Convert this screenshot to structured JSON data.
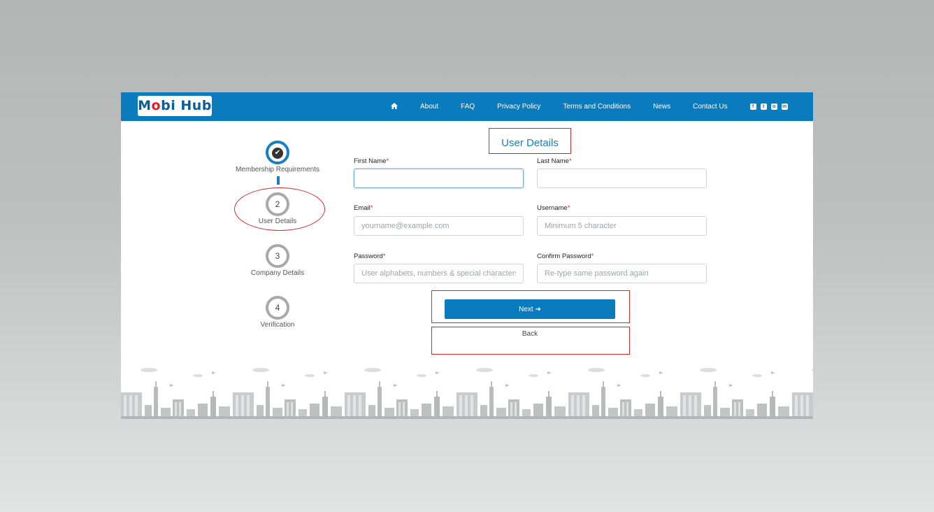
{
  "header": {
    "logo": {
      "part1": "M",
      "dot_char": "o",
      "part2": "bi Hub"
    },
    "nav": {
      "home_icon": "home-icon",
      "items": [
        "About",
        "FAQ",
        "Privacy Policy",
        "Terms and Conditions",
        "News",
        "Contact Us"
      ]
    },
    "social_icons": [
      "facebook-icon",
      "twitter-icon",
      "instagram-icon",
      "linkedin-icon"
    ],
    "colors": {
      "bar": "#0a7bbd"
    }
  },
  "stepper": {
    "steps": [
      {
        "number": "✔",
        "label": "Membership Requirements",
        "state": "done"
      },
      {
        "number": "2",
        "label": "User Details",
        "state": "current"
      },
      {
        "number": "3",
        "label": "Company Details",
        "state": "pending"
      },
      {
        "number": "4",
        "label": "Verification",
        "state": "pending"
      }
    ]
  },
  "form": {
    "title": "User Details",
    "fields": {
      "first_name": {
        "label": "First Name",
        "req": "*",
        "value": "",
        "placeholder": ""
      },
      "last_name": {
        "label": "Last Name",
        "req": "*",
        "value": "",
        "placeholder": ""
      },
      "email": {
        "label": "Email",
        "req": "*",
        "value": "",
        "placeholder": "yourname@example.com"
      },
      "username": {
        "label": "Username",
        "req": "*",
        "value": "",
        "placeholder": "Minimum 5 character"
      },
      "password": {
        "label": "Password",
        "req": "*",
        "value": "",
        "placeholder": "User alphabets, numbers & special characters"
      },
      "confirm_password": {
        "label": "Confirm Password",
        "req": "*",
        "value": "",
        "placeholder": "Re-type same password again"
      }
    },
    "next_label": "Next ➔",
    "back_label": "Back"
  },
  "colors": {
    "accent": "#1a7fc1",
    "annotation": "#d3272e"
  }
}
